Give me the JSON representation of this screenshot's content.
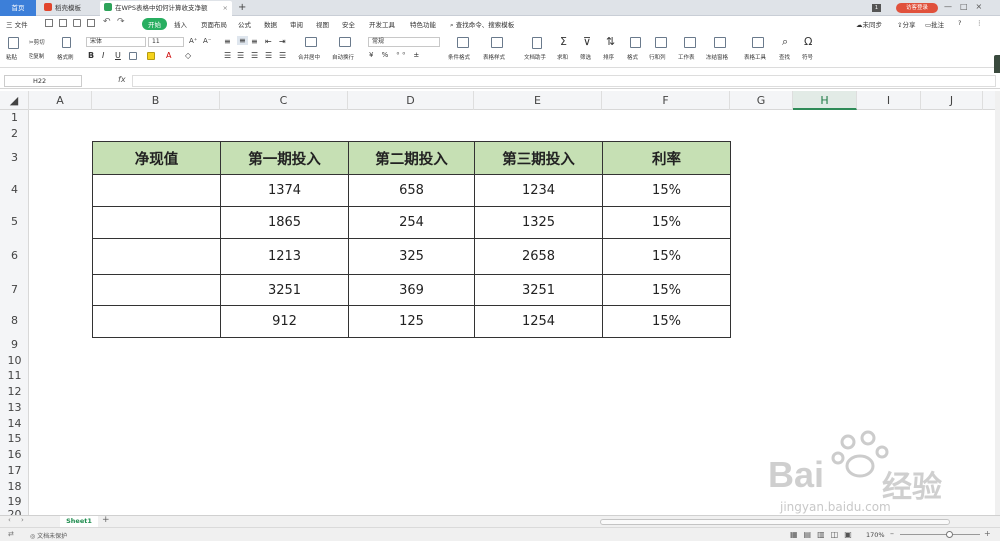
{
  "tabs": {
    "home": "首页",
    "template": "稻壳模板",
    "doc": "在WPS表格中如何计算收支净额"
  },
  "login_label": "访客登录",
  "menu": {
    "file": "三 文件",
    "items": [
      "开始",
      "插入",
      "页面布局",
      "公式",
      "数据",
      "审阅",
      "视图",
      "安全",
      "开发工具",
      "特色功能"
    ],
    "active": "开始",
    "search": "查找命令、搜索模板",
    "sync": "未同步",
    "share": "分享",
    "comment": "批注"
  },
  "toolbar": {
    "paste": "粘贴",
    "cut": "剪切",
    "copy": "复制",
    "format_painter": "格式刷",
    "font_name": "宋体",
    "font_size": "11",
    "merge": "合并居中",
    "wrap": "自动换行",
    "number_format": "常规",
    "cond_format": "条件格式",
    "table_style": "表格样式",
    "doc_assistant": "文档助手",
    "sum": "求和",
    "filter": "筛选",
    "sort": "排序",
    "format": "格式",
    "row_col": "行和列",
    "worksheet": "工作表",
    "freeze": "冻结窗格",
    "table_tools": "表格工具",
    "find": "查找",
    "symbol": "符号"
  },
  "formula_bar": {
    "cell_ref": "H22",
    "fx": "fx",
    "content": ""
  },
  "columns": [
    "A",
    "B",
    "C",
    "D",
    "E",
    "F",
    "G",
    "H",
    "I",
    "J"
  ],
  "selected_column": "H",
  "rows": [
    "1",
    "2",
    "3",
    "4",
    "5",
    "6",
    "7",
    "8",
    "9",
    "10",
    "11",
    "12",
    "13",
    "14",
    "15",
    "16",
    "17",
    "18",
    "19",
    "20"
  ],
  "table": {
    "headers": [
      "净现值",
      "第一期投入",
      "第二期投入",
      "第三期投入",
      "利率"
    ],
    "rows": [
      [
        "",
        "1374",
        "658",
        "1234",
        "15%"
      ],
      [
        "",
        "1865",
        "254",
        "1325",
        "15%"
      ],
      [
        "",
        "1213",
        "325",
        "2658",
        "15%"
      ],
      [
        "",
        "3251",
        "369",
        "3251",
        "15%"
      ],
      [
        "",
        "912",
        "125",
        "1254",
        "15%"
      ]
    ]
  },
  "sheet_tab": "Sheet1",
  "status": {
    "protect": "文档未保护",
    "zoom": "170%"
  },
  "watermark": {
    "brand": "Bai",
    "brand_cn": "经验",
    "url": "jingyan.baidu.com"
  },
  "colors": {
    "accent": "#27ae60",
    "header_fill": "#c6e0b4",
    "home_tab": "#3c7fd9",
    "login": "#e0513c"
  }
}
